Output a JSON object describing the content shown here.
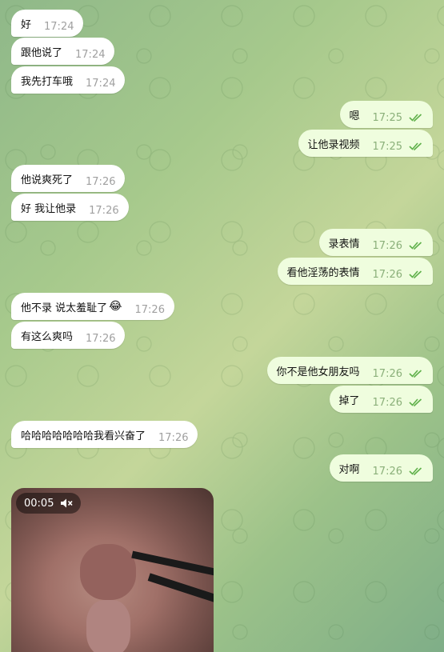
{
  "messages": [
    {
      "dir": "in",
      "text": "好",
      "time": "17:24"
    },
    {
      "dir": "in",
      "text": "跟他说了",
      "time": "17:24"
    },
    {
      "dir": "in",
      "text": "我先打车哦",
      "time": "17:24"
    },
    {
      "dir": "out",
      "text": "嗯",
      "time": "17:25"
    },
    {
      "dir": "out",
      "text": "让他录视频",
      "time": "17:25"
    },
    {
      "dir": "in",
      "text": "他说爽死了",
      "time": "17:26"
    },
    {
      "dir": "in",
      "text": "好 我让他录",
      "time": "17:26"
    },
    {
      "dir": "out",
      "text": "录表情",
      "time": "17:26"
    },
    {
      "dir": "out",
      "text": "看他淫荡的表情",
      "time": "17:26"
    },
    {
      "dir": "in",
      "text": "他不录 说太羞耻了",
      "emoji": "😂",
      "time": "17:26"
    },
    {
      "dir": "in",
      "text": "有这么爽吗",
      "time": "17:26"
    },
    {
      "dir": "out",
      "text": "你不是他女朋友吗",
      "time": "17:26"
    },
    {
      "dir": "out",
      "text": "掉了",
      "time": "17:26"
    },
    {
      "dir": "in",
      "text": "哈哈哈哈哈哈哈我看兴奋了",
      "time": "17:26"
    },
    {
      "dir": "out",
      "text": "对啊",
      "time": "17:26"
    }
  ],
  "video": {
    "duration": "00:05",
    "muted": true
  },
  "colors": {
    "incoming": "#ffffff",
    "outgoing": "#effdde",
    "read_ticks": "#5fb04a"
  }
}
